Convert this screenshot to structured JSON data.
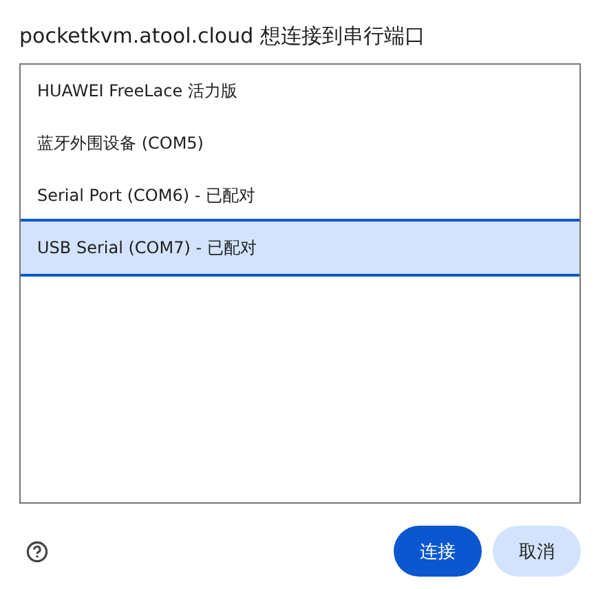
{
  "dialog": {
    "title": "pocketkvm.atool.cloud 想连接到串行端口"
  },
  "devices": [
    {
      "label": "HUAWEI FreeLace 活力版",
      "selected": false
    },
    {
      "label": "蓝牙外围设备 (COM5)",
      "selected": false
    },
    {
      "label": "Serial Port (COM6) - 已配对",
      "selected": false
    },
    {
      "label": "USB Serial (COM7) - 已配对",
      "selected": true
    }
  ],
  "buttons": [
    {
      "label": "连接",
      "kind": "primary"
    },
    {
      "label": "取消",
      "kind": "secondary"
    }
  ]
}
